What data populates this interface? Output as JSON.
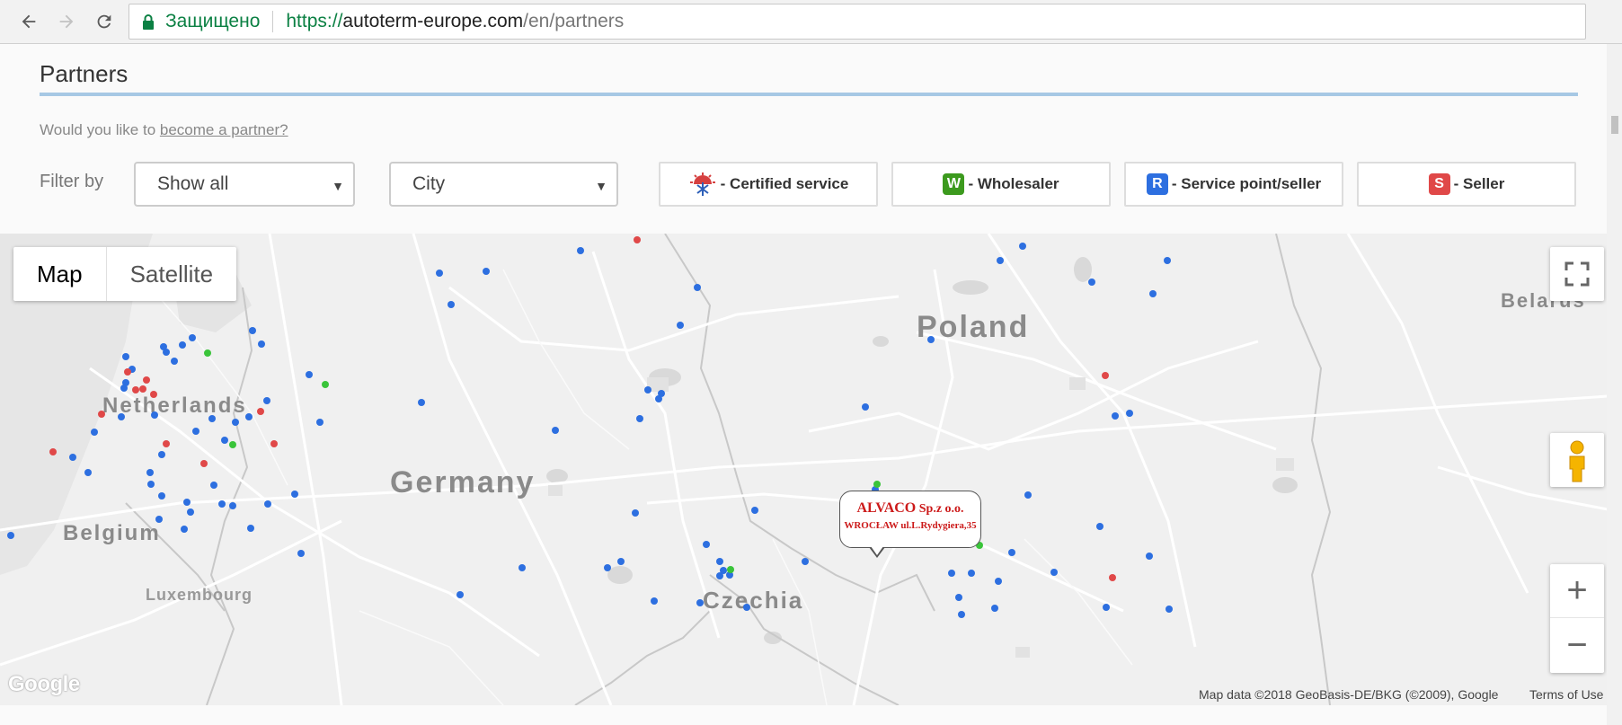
{
  "browser": {
    "secure_label": "Защищено",
    "url_scheme": "https://",
    "url_host": "autoterm-europe.com",
    "url_path": "/en/partners"
  },
  "page": {
    "title": "Partners",
    "become_prefix": "Would you like to ",
    "become_link": "become a partner?",
    "filter_label": "Filter by",
    "filter_type_value": "Show all",
    "filter_city_value": "City"
  },
  "legend": [
    {
      "label": "- Certified service",
      "badge": "",
      "color": "#d64040"
    },
    {
      "label": "- Wholesaler",
      "badge": "W",
      "color": "#3c9a1e"
    },
    {
      "label": "- Service point/seller",
      "badge": "R",
      "color": "#2d6fe0"
    },
    {
      "label": "- Seller",
      "badge": "S",
      "color": "#e04848"
    }
  ],
  "map": {
    "type_map": "Map",
    "type_satellite": "Satellite",
    "countries": {
      "poland": "Poland",
      "germany": "Germany",
      "netherlands": "Netherlands",
      "belgium": "Belgium",
      "luxembourg": "Luxembourg",
      "czechia": "Czechia",
      "belarus": "Belarus"
    },
    "info_window": {
      "name_bold": "ALVACO",
      "name_rest": " Sp.z o.o.",
      "address": "WROCŁAW ul.L.Rydygiera,35"
    },
    "zoom_in": "+",
    "zoom_out": "−",
    "google_logo": "Google",
    "attribution": "Map data ©2018 GeoBasis-DE/BKG (©2009), Google",
    "terms": "Terms of Use",
    "marker_colors": {
      "service_point": "#2d6fe0",
      "seller": "#e04848",
      "wholesaler": "#3ac43a"
    }
  }
}
